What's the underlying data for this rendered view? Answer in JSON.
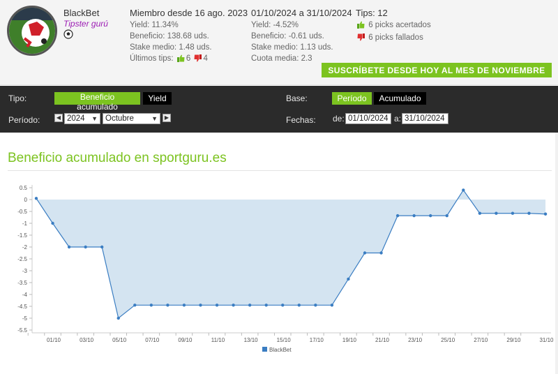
{
  "profile": {
    "name": "BlackBet",
    "role": "Tipster gurú",
    "member_since": "Miembro desde 16 ago. 2023",
    "yield": "Yield: 11.34%",
    "profit": "Beneficio: 138.68 uds.",
    "stake": "Stake medio: 1.48 uds.",
    "last_tips_label": "Últimos tips:",
    "last_tips_won": "6",
    "last_tips_lost": "4"
  },
  "period_stats": {
    "range": "01/10/2024 a 31/10/2024",
    "yield": "Yield: -4.52%",
    "profit": "Beneficio: -0.61 uds.",
    "stake": "Stake medio: 1.13 uds.",
    "odds": "Cuota media: 2.3"
  },
  "tips": {
    "total": "Tips: 12",
    "won": "6 picks acertados",
    "lost": "6 picks fallados"
  },
  "subscribe_label": "SUSCRÍBETE DESDE HOY AL MES DE NOVIEMBRE",
  "filters": {
    "tipo_label": "Tipo:",
    "tipo_options": [
      "Beneficio acumulado",
      "Yield"
    ],
    "base_label": "Base:",
    "base_options": [
      "Período",
      "Acumulado"
    ],
    "periodo_label": "Período:",
    "year": "2024",
    "month": "Octubre",
    "fechas_label": "Fechas:",
    "from_label": "de:",
    "from": "01/10/2024",
    "to_label": "a:",
    "to": "31/10/2024"
  },
  "colors": {
    "accent": "#7cc320",
    "series": "#3a7dc2",
    "fill": "#d4e4f1",
    "role": "#9b1bb3"
  },
  "chart_title": "Beneficio acumulado en sportguru.es",
  "chart_data": {
    "type": "area",
    "title": "Beneficio acumulado en sportguru.es",
    "xlabel": "",
    "ylabel": "",
    "x": [
      "01/10",
      "02/10",
      "03/10",
      "04/10",
      "05/10",
      "06/10",
      "07/10",
      "08/10",
      "09/10",
      "10/10",
      "11/10",
      "12/10",
      "13/10",
      "14/10",
      "15/10",
      "16/10",
      "17/10",
      "18/10",
      "19/10",
      "20/10",
      "21/10",
      "22/10",
      "23/10",
      "24/10",
      "25/10",
      "26/10",
      "27/10",
      "28/10",
      "29/10",
      "30/10",
      "31/10"
    ],
    "x_tick_labels": [
      "01/10",
      "03/10",
      "05/10",
      "07/10",
      "09/10",
      "11/10",
      "13/10",
      "15/10",
      "17/10",
      "19/10",
      "21/10",
      "23/10",
      "25/10",
      "27/10",
      "29/10",
      "31/10"
    ],
    "y_ticks": [
      "0.5",
      "0",
      "-0.5",
      "-1",
      "-1.5",
      "-2",
      "-2.5",
      "-3",
      "-3.5",
      "-4",
      "-4.5",
      "-5",
      "-5.5"
    ],
    "ylim": [
      -5.5,
      0.5
    ],
    "grid": false,
    "legend": "bottom-center",
    "series": [
      {
        "name": "BlackBet",
        "values": [
          0.05,
          -1,
          -2,
          -2,
          -2,
          -5,
          -4.45,
          -4.45,
          -4.45,
          -4.45,
          -4.45,
          -4.45,
          -4.45,
          -4.45,
          -4.45,
          -4.45,
          -4.45,
          -4.45,
          -4.45,
          -3.35,
          -2.25,
          -2.25,
          -0.68,
          -0.68,
          -0.68,
          -0.68,
          0.4,
          -0.58,
          -0.58,
          -0.58,
          -0.58,
          -0.61
        ]
      }
    ]
  }
}
